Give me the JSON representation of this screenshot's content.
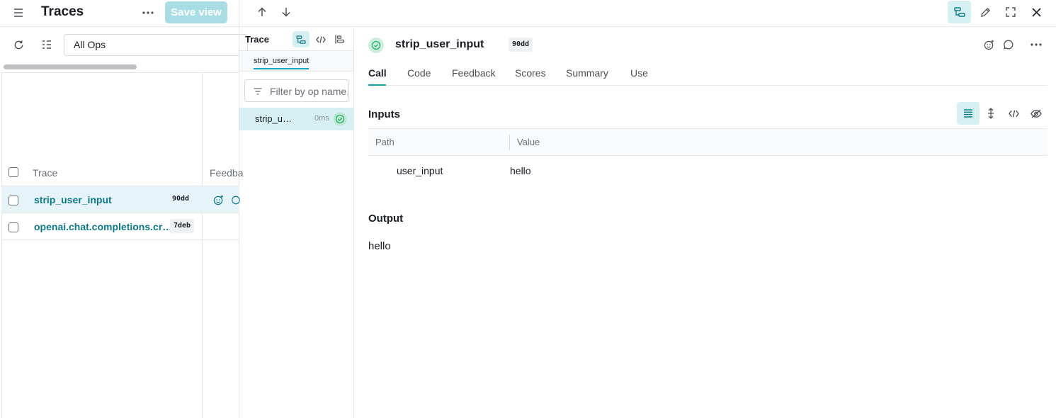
{
  "left_panel": {
    "title": "Traces",
    "save_view_label": "Save view",
    "filter_value": "All Ops",
    "columns": {
      "trace": "Trace",
      "feedback": "Feedba"
    },
    "rows": [
      {
        "name": "strip_user_input",
        "id": "90dd"
      },
      {
        "name": "openai.chat.completions.cr…",
        "id": "7deb"
      }
    ]
  },
  "trace_tree": {
    "title": "Trace",
    "tab_label": "strip_user_input",
    "filter_placeholder": "Filter by op name...",
    "node": {
      "name": "strip_u…",
      "duration": "0ms"
    }
  },
  "call_detail": {
    "name": "strip_user_input",
    "id_badge": "90dd",
    "tabs": [
      "Call",
      "Code",
      "Feedback",
      "Scores",
      "Summary",
      "Use"
    ],
    "inputs_title": "Inputs",
    "grid_headers": {
      "path": "Path",
      "value": "Value"
    },
    "inputs": [
      {
        "path": "user_input",
        "value": "hello"
      }
    ],
    "output_title": "Output",
    "output_value": "hello"
  },
  "colors": {
    "accent": "#13a9ba",
    "link": "#0e7888",
    "selected_row": "#e6f3f8",
    "success": "#20b16a"
  },
  "icons": [
    "menu-icon",
    "more-horizontal-icon",
    "refresh-icon",
    "columns-icon",
    "arrow-up-icon",
    "arrow-down-icon",
    "tree-view-icon",
    "edit-icon",
    "fullscreen-icon",
    "close-icon",
    "code-icon",
    "flamegraph-icon",
    "filter-icon",
    "check-circle-icon",
    "add-reaction-icon",
    "comment-icon",
    "list-view-icon",
    "expand-icon",
    "hide-icon"
  ]
}
